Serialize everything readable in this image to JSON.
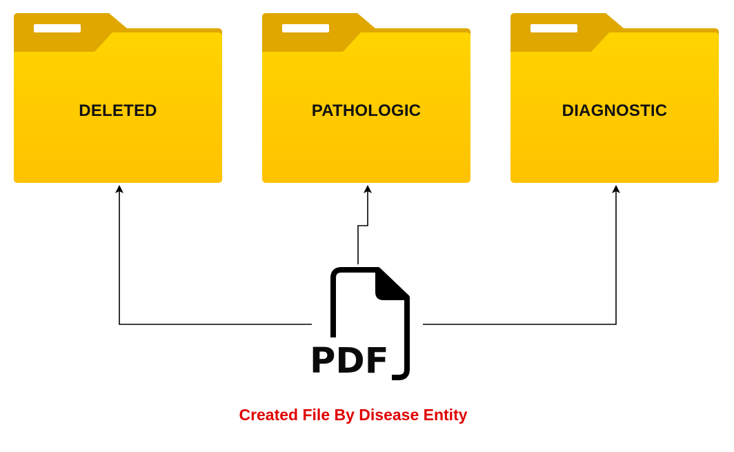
{
  "folders": [
    {
      "id": "deleted",
      "label": "DELETED"
    },
    {
      "id": "pathologic",
      "label": "PATHOLOGIC"
    },
    {
      "id": "diagnostic",
      "label": "DIAGNOSTIC"
    }
  ],
  "file": {
    "icon": "pdf-file-icon",
    "label": "PDF"
  },
  "caption": "Created File By Disease Entity",
  "colors": {
    "folder_front_top": "#FFD200",
    "folder_front_bottom": "#FFC300",
    "folder_back": "#E0A800",
    "folder_tab_slot": "#FFFFFF",
    "label_text": "#111111",
    "connector": "#000000",
    "caption_text": "#E00000"
  }
}
